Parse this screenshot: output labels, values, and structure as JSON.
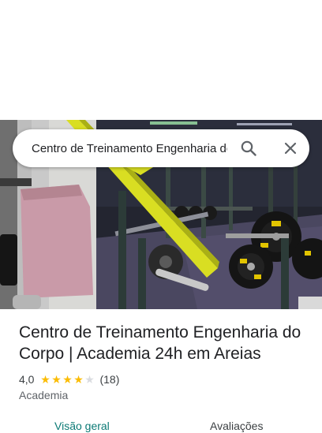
{
  "search": {
    "query": "Centro de Treinamento Engenharia do Corpo",
    "search_icon": "search-icon",
    "close_icon": "close-icon"
  },
  "place": {
    "title": "Centro de Treinamento Engenharia do Corpo | Academia 24h em Areias",
    "rating_value": "4,0",
    "rating_stars": 4,
    "review_count": "(18)",
    "category": "Academia"
  },
  "tabs": [
    {
      "label": "Visão geral",
      "selected": true
    },
    {
      "label": "Avaliações",
      "selected": false
    }
  ],
  "colors": {
    "star": "#fbbc04",
    "star_empty": "#dadce0",
    "tab_selected": "#0b7a75"
  }
}
